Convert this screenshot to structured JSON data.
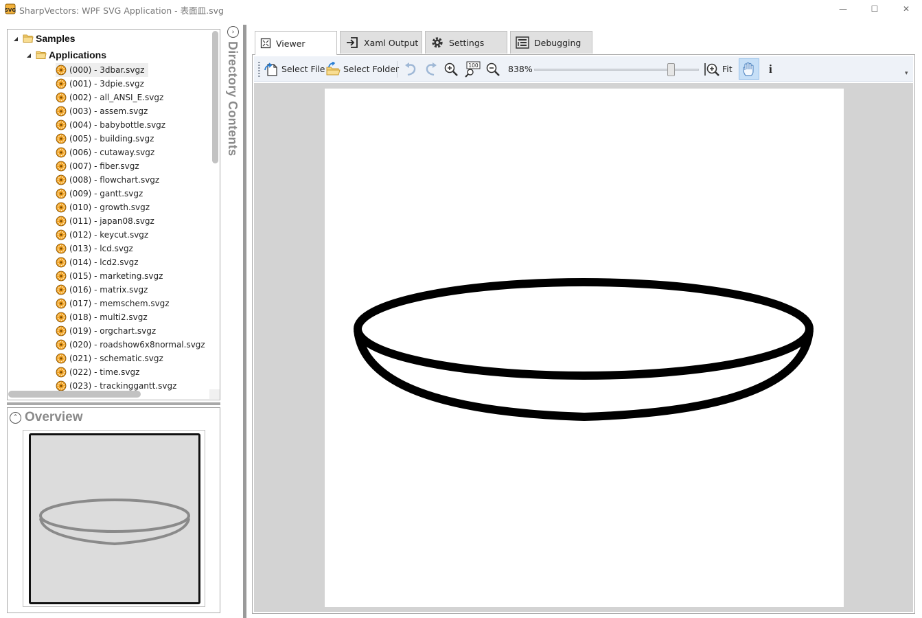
{
  "window": {
    "title": "SharpVectors: WPF SVG Application - 表面皿.svg",
    "minimize_glyph": "—",
    "maximize_glyph": "☐",
    "close_glyph": "✕"
  },
  "tree": {
    "root_label": "Samples",
    "group_label": "Applications",
    "files": [
      "(000) - 3dbar.svgz",
      "(001) - 3dpie.svgz",
      "(002) - all_ANSI_E.svgz",
      "(003) - assem.svgz",
      "(004) - babybottle.svgz",
      "(005) - building.svgz",
      "(006) - cutaway.svgz",
      "(007) - fiber.svgz",
      "(008) - flowchart.svgz",
      "(009) - gantt.svgz",
      "(010) - growth.svgz",
      "(011) - japan08.svgz",
      "(012) - keycut.svgz",
      "(013) - lcd.svgz",
      "(014) - lcd2.svgz",
      "(015) - marketing.svgz",
      "(016) - matrix.svgz",
      "(017) - memschem.svgz",
      "(018) - multi2.svgz",
      "(019) - orgchart.svgz",
      "(020) - roadshow6x8normal.svgz",
      "(021) - schematic.svgz",
      "(022) - time.svgz",
      "(023) - trackinggantt.svgz"
    ]
  },
  "overview": {
    "title": "Overview"
  },
  "directory_contents": {
    "label": "Directory Contents"
  },
  "tabs": [
    {
      "label": "Viewer",
      "icon": "viewer-icon"
    },
    {
      "label": "Xaml Output",
      "icon": "xaml-output-icon"
    },
    {
      "label": "Settings",
      "icon": "gear-icon"
    },
    {
      "label": "Debugging",
      "icon": "debugging-icon"
    }
  ],
  "toolbar": {
    "select_file": "Select File",
    "select_folder": "Select Folder",
    "zoom_level": "838%",
    "zoom_100": "100",
    "fit": "Fit",
    "info": "i"
  },
  "colors": {
    "accent_file_icon": "#f0a020",
    "toolbar_bg": "#eef2f8",
    "viewport_bg": "#d3d3d3",
    "overview_stroke": "#8a8a8a"
  }
}
